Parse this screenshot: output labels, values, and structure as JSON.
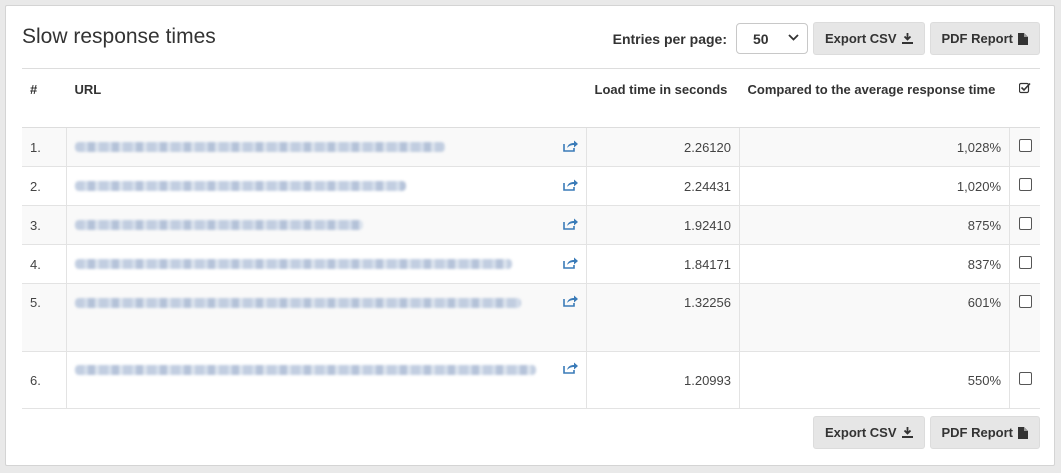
{
  "title": "Slow response times",
  "controls": {
    "entries_label": "Entries per page:",
    "entries_value": "50",
    "export_csv": "Export CSV",
    "pdf_report": "PDF Report"
  },
  "table": {
    "headers": {
      "num": "#",
      "url": "URL",
      "load_time": "Load time in seconds",
      "compared": "Compared to the average response time"
    },
    "rows": [
      {
        "num": "1.",
        "load": "2.26120",
        "pct": "1,028%",
        "url_fill": 0.77
      },
      {
        "num": "2.",
        "load": "2.24431",
        "pct": "1,020%",
        "url_fill": 0.69
      },
      {
        "num": "3.",
        "load": "1.92410",
        "pct": "875%",
        "url_fill": 0.6
      },
      {
        "num": "4.",
        "load": "1.84171",
        "pct": "837%",
        "url_fill": 0.91
      },
      {
        "num": "5.",
        "load": "1.32256",
        "pct": "601%",
        "url_fill": 0.93
      },
      {
        "num": "6.",
        "load": "1.20993",
        "pct": "550%",
        "url_fill": 0.96
      }
    ]
  },
  "colors": {
    "link_icon": "#3a7bb8",
    "button_bg": "#e6e6e6"
  },
  "icons": {
    "export": "download-icon",
    "pdf": "file-icon",
    "url_link": "external-link-icon",
    "header_check": "check-square-icon"
  }
}
